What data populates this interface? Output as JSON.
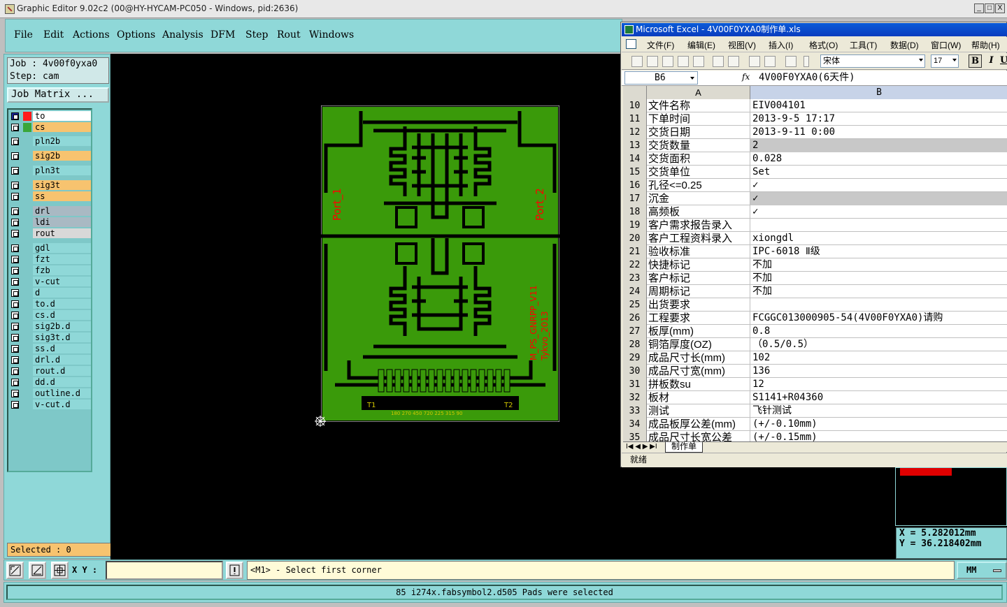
{
  "app": {
    "title": "Graphic Editor 9.02c2 (00@HY-HYCAM-PC050 - Windows, pid:2636)",
    "window_buttons": [
      "_",
      "□",
      "X"
    ]
  },
  "menu": [
    "File",
    "Edit",
    "Actions",
    "Options",
    "Analysis",
    "DFM",
    "Step",
    "Rout",
    "Windows"
  ],
  "job": {
    "job_line": "Job : 4v00f0yxa0",
    "step_line": "Step: cam",
    "matrix_button": "Job Matrix ..."
  },
  "layers": [
    {
      "name": "to",
      "color": "#ffffff",
      "swatch": "#ff1a1a",
      "active": true
    },
    {
      "name": "cs",
      "color": "#f7c36f",
      "swatch": "#3aa63a",
      "active": false
    },
    {
      "name": "pln2b",
      "color": "#8fd8d8",
      "swatch": "",
      "active": false
    },
    {
      "name": "sig2b",
      "color": "#f7c36f",
      "swatch": "",
      "active": false
    },
    {
      "name": "pln3t",
      "color": "#8fd8d8",
      "swatch": "",
      "active": false
    },
    {
      "name": "sig3t",
      "color": "#f7c36f",
      "swatch": "",
      "active": false
    },
    {
      "name": "ss",
      "color": "#f7c36f",
      "swatch": "",
      "active": false
    },
    {
      "name": "drl",
      "color": "#a9b9c3",
      "swatch": "",
      "active": false
    },
    {
      "name": "ldi",
      "color": "#a9b9c3",
      "swatch": "",
      "active": false
    },
    {
      "name": "rout",
      "color": "#d8d8d8",
      "swatch": "",
      "active": false
    },
    {
      "name": "gdl",
      "color": "#8fd8d8",
      "swatch": "",
      "active": false
    },
    {
      "name": "fzt",
      "color": "#8fd8d8",
      "swatch": "",
      "active": false
    },
    {
      "name": "fzb",
      "color": "#8fd8d8",
      "swatch": "",
      "active": false
    },
    {
      "name": "v-cut",
      "color": "#8fd8d8",
      "swatch": "",
      "active": false
    },
    {
      "name": "d",
      "color": "#8fd8d8",
      "swatch": "",
      "active": false
    },
    {
      "name": "to.d",
      "color": "#8fd8d8",
      "swatch": "",
      "active": false
    },
    {
      "name": "cs.d",
      "color": "#8fd8d8",
      "swatch": "",
      "active": false
    },
    {
      "name": "sig2b.d",
      "color": "#8fd8d8",
      "swatch": "",
      "active": false
    },
    {
      "name": "sig3t.d",
      "color": "#8fd8d8",
      "swatch": "",
      "active": false
    },
    {
      "name": "ss.d",
      "color": "#8fd8d8",
      "swatch": "",
      "active": false
    },
    {
      "name": "drl.d",
      "color": "#8fd8d8",
      "swatch": "",
      "active": false
    },
    {
      "name": "rout.d",
      "color": "#8fd8d8",
      "swatch": "",
      "active": false
    },
    {
      "name": "dd.d",
      "color": "#8fd8d8",
      "swatch": "",
      "active": false
    },
    {
      "name": "outline.d",
      "color": "#8fd8d8",
      "swatch": "",
      "active": false
    },
    {
      "name": "v-cut.d",
      "color": "#8fd8d8",
      "swatch": "",
      "active": false
    }
  ],
  "selected_label": "Selected : 0",
  "pcb": {
    "port1": "Port_1",
    "port2": "Port_2",
    "vlabel1": "M_PS_GNRPP_V11",
    "vlabel2": "Tykvo_2013",
    "t1": "T1",
    "t2": "T2",
    "bottom_numbers": "180 270 450 720 225 315 90",
    "copper_color": "#3a9a0a",
    "trace_color": "#000000",
    "label_color": "#ff0000"
  },
  "excel": {
    "title": "Microsoft Excel - 4V00F0YXA0制作单.xls",
    "menu": [
      "文件(F)",
      "编辑(E)",
      "视图(V)",
      "插入(I)",
      "格式(O)",
      "工具(T)",
      "数据(D)",
      "窗口(W)",
      "帮助(H)"
    ],
    "font": "宋体",
    "size": "17",
    "bold": "B",
    "italic": "I",
    "underline": "U",
    "cell_ref": "B6",
    "fx": "fx",
    "formula": "4V00F0YXA0(6天件)",
    "col_a": "A",
    "col_b": "B",
    "rows": [
      {
        "n": "10",
        "a": "文件名称",
        "b": "EIV004101",
        "gray": false
      },
      {
        "n": "11",
        "a": "下单时间",
        "b": "2013-9-5 17:17",
        "gray": false
      },
      {
        "n": "12",
        "a": "交货日期",
        "b": "2013-9-11  0:00",
        "gray": false
      },
      {
        "n": "13",
        "a": "交货数量",
        "b": "2",
        "gray": true
      },
      {
        "n": "14",
        "a": "交货面积",
        "b": "0.028",
        "gray": false
      },
      {
        "n": "15",
        "a": "交货单位",
        "b": "Set",
        "gray": false
      },
      {
        "n": "16",
        "a": "孔径<=0.25",
        "b": "✓",
        "gray": false
      },
      {
        "n": "17",
        "a": "沉金",
        "b": "✓",
        "gray": true
      },
      {
        "n": "18",
        "a": "高频板",
        "b": "✓",
        "gray": false
      },
      {
        "n": "19",
        "a": "客户需求报告录入",
        "b": "",
        "gray": false
      },
      {
        "n": "20",
        "a": "客户工程资料录入",
        "b": "xiongdl",
        "gray": false
      },
      {
        "n": "21",
        "a": "验收标准",
        "b": "IPC-6018 Ⅱ级",
        "gray": false
      },
      {
        "n": "22",
        "a": "快捷标记",
        "b": "不加",
        "gray": false
      },
      {
        "n": "23",
        "a": "客户标记",
        "b": "不加",
        "gray": false
      },
      {
        "n": "24",
        "a": "周期标记",
        "b": "不加",
        "gray": false
      },
      {
        "n": "25",
        "a": "出货要求",
        "b": "",
        "gray": false
      },
      {
        "n": "26",
        "a": "工程要求",
        "b": "FCGGC013000905-54(4V00F0YXA0)请购",
        "gray": false
      },
      {
        "n": "27",
        "a": "板厚(mm)",
        "b": "0.8",
        "gray": false
      },
      {
        "n": "28",
        "a": "铜箔厚度(OZ)",
        "b": "（0.5/0.5）",
        "gray": false
      },
      {
        "n": "29",
        "a": "成品尺寸长(mm)",
        "b": "102",
        "gray": false
      },
      {
        "n": "30",
        "a": "成品尺寸宽(mm)",
        "b": "136",
        "gray": false
      },
      {
        "n": "31",
        "a": "拼板数su",
        "b": "12",
        "gray": false
      },
      {
        "n": "32",
        "a": "板材",
        "b": "S1141+R04360",
        "gray": false
      },
      {
        "n": "33",
        "a": "测试",
        "b": "飞针测试",
        "gray": false
      },
      {
        "n": "34",
        "a": "成品板厚公差(mm)",
        "b": "(+/-0.10mm)",
        "gray": false
      },
      {
        "n": "35",
        "a": "成品尺寸长宽公差",
        "b": "(+/-0.15mm)",
        "gray": false
      }
    ],
    "sheet_tab": "制作单",
    "sheet_nav": "I◀ ◀ ▶ ▶I",
    "status": "就绪"
  },
  "coords": {
    "x": "X  =  5.282012mm",
    "y": "Y  =  36.218402mm"
  },
  "bottom": {
    "xy_label": "X Y :",
    "xy_value": "",
    "message": "<M1> - Select first corner",
    "units": "MM",
    "status": "85 i274x.fabsymbol2.d505 Pads were selected"
  }
}
